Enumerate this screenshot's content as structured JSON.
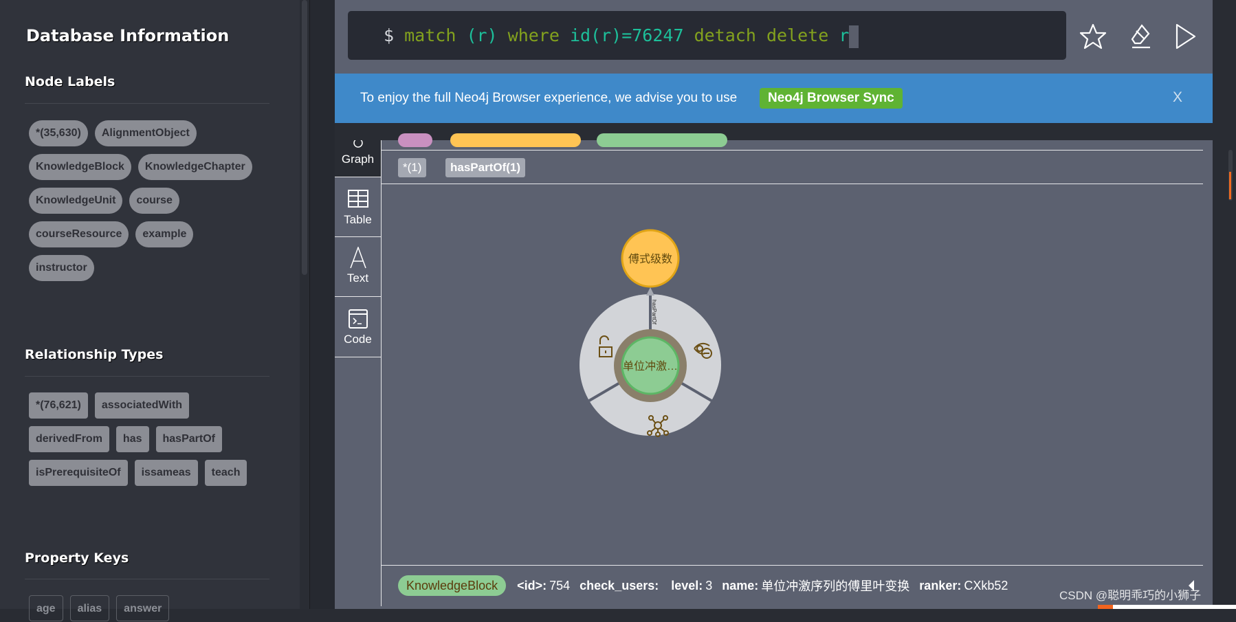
{
  "sidebar": {
    "title": "Database Information",
    "node_labels_heading": "Node Labels",
    "node_labels": [
      "*(35,630)",
      "AlignmentObject",
      "KnowledgeBlock",
      "KnowledgeChapter",
      "KnowledgeUnit",
      "course",
      "courseResource",
      "example",
      "instructor"
    ],
    "relationship_types_heading": "Relationship Types",
    "relationship_types": [
      "*(76,621)",
      "associatedWith",
      "derivedFrom",
      "has",
      "hasPartOf",
      "isPrerequisiteOf",
      "issameas",
      "teach"
    ],
    "property_keys_heading": "Property Keys",
    "property_keys": [
      "age",
      "alias",
      "answer"
    ]
  },
  "editor": {
    "prompt": "$",
    "tokens": {
      "t1": "match ",
      "t2": "(r)",
      "t3": " where ",
      "t4": "id(r)=76247",
      "t5": " detach delete ",
      "t6": "r"
    }
  },
  "banner": {
    "message": "To enjoy the full Neo4j Browser experience, we advise you to use",
    "link": "Neo4j Browser Sync",
    "close": "X"
  },
  "tabs": {
    "graph": "Graph",
    "table": "Table",
    "text": "Text",
    "code": "Code"
  },
  "result": {
    "count_pills": [
      "*(1)",
      "hasPartOf(1)"
    ]
  },
  "graph": {
    "nodes": [
      {
        "label": "傅式级数",
        "color": "#ffc454"
      },
      {
        "label": "单位冲激…",
        "color": "#8dcc93"
      }
    ],
    "relationship": "hasPartOf"
  },
  "details": {
    "label": "KnowledgeBlock",
    "props": [
      {
        "k": "<id>:",
        "v": "754"
      },
      {
        "k": "check_users:",
        "v": ""
      },
      {
        "k": "level:",
        "v": "3"
      },
      {
        "k": "name:",
        "v": "单位冲激序列的傅里叶变换"
      },
      {
        "k": "ranker:",
        "v": "CXkb52"
      }
    ]
  },
  "watermark": "CSDN @聪明乖巧的小狮子"
}
